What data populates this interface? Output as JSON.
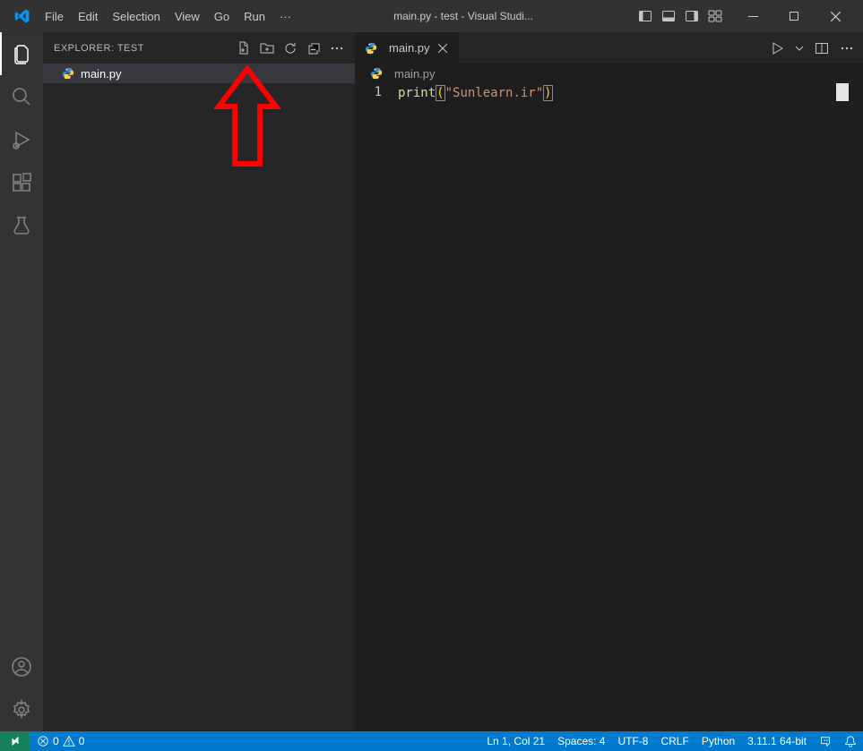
{
  "title_bar": {
    "app_title": "main.py - test - Visual Studi...",
    "menu": [
      "File",
      "Edit",
      "Selection",
      "View",
      "Go",
      "Run",
      "···"
    ]
  },
  "activity_bar": {
    "items_top": [
      "explorer",
      "search",
      "debug",
      "extensions",
      "testing"
    ],
    "items_bottom": [
      "account",
      "settings"
    ]
  },
  "sidebar": {
    "title": "EXPLORER: TEST",
    "file_name": "main.py"
  },
  "editor": {
    "tab_label": "main.py",
    "breadcrumb_file": "main.py",
    "line_number": "1",
    "code": {
      "fn": "print",
      "lparen": "(",
      "string": "\"Sunlearn.ir\"",
      "rparen": ")"
    }
  },
  "status_bar": {
    "errors": "0",
    "warnings": "0",
    "cursor_position": "Ln 1, Col 21",
    "spaces": "Spaces: 4",
    "encoding": "UTF-8",
    "eol": "CRLF",
    "language": "Python",
    "interpreter": "3.11.1 64-bit"
  }
}
